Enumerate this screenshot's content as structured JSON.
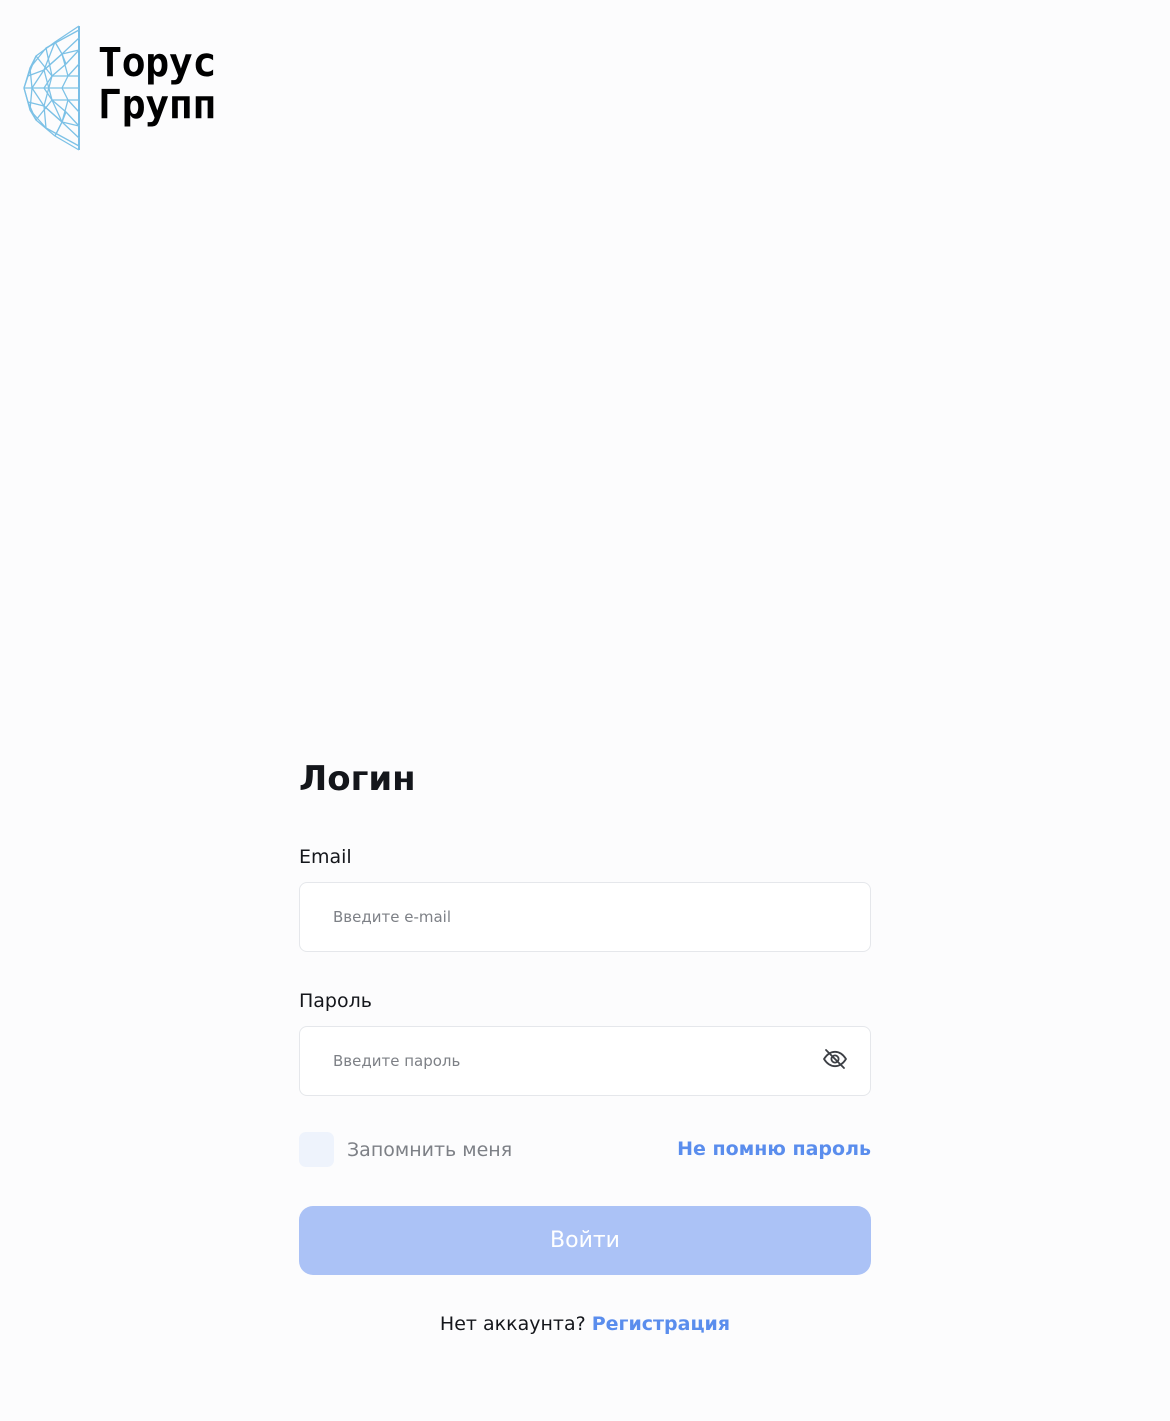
{
  "brand": {
    "line1": "Торус",
    "line2": "Групп"
  },
  "login": {
    "title": "Логин",
    "email_label": "Email",
    "email_placeholder": "Введите e-mail",
    "password_label": "Пароль",
    "password_placeholder": "Введите пароль",
    "remember_label": "Запомнить меня",
    "forgot_label": "Не помню пароль",
    "submit_label": "Войти",
    "no_account_text": "Нет аккаунта?",
    "register_label": "Регистрация"
  },
  "icons": {
    "password_toggle": "eye-off-icon",
    "logo": "torus-mesh-icon"
  },
  "colors": {
    "accent": "#5a8ded",
    "button_disabled": "#abc2f6",
    "logo_mesh": "#7cc1e6"
  }
}
